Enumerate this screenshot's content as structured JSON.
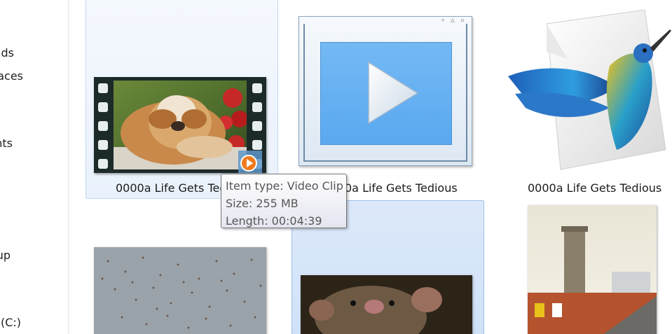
{
  "nav": {
    "items": [
      {
        "label": "Downloads",
        "partial": "ds"
      },
      {
        "label": "Recent Places",
        "partial": "aces"
      },
      {
        "label": "Documents",
        "partial": "nts"
      },
      {
        "label": "Homegroup",
        "partial": "up"
      },
      {
        "label": "Local Disk (C:)",
        "partial": "(C:)"
      }
    ]
  },
  "files": [
    {
      "name": "0000a Life Gets Tedious",
      "display": "0000a Life Gets Tec",
      "type": "video-clip",
      "state": "hover"
    },
    {
      "name": "0000a Life Gets Tedious",
      "display": "0a Life Gets Tedious",
      "type": "media-player",
      "state": "normal"
    },
    {
      "name": "0000a Life Gets Tedious",
      "display": "0000a Life Gets Tedious",
      "type": "photo-app",
      "state": "normal"
    },
    {
      "name": "",
      "type": "video-birds",
      "state": "normal"
    },
    {
      "name": "",
      "type": "video-rat",
      "state": "selected"
    },
    {
      "name": "",
      "type": "photo-building",
      "state": "normal"
    }
  ],
  "tooltip": {
    "item_type": "Item type: Video Clip",
    "size": "Size: 255 MB",
    "length": "Length: 00:04:39"
  },
  "colors": {
    "hover_border": "#c4d8f1",
    "selected_border": "#9cc0ea",
    "play_blue": "#5aa8f0",
    "badge_orange": "#f07a1e"
  },
  "icons": {
    "film": "film-strip-icon",
    "play": "play-triangle-icon",
    "badge": "play-badge-icon",
    "bird": "hummingbird-icon"
  }
}
